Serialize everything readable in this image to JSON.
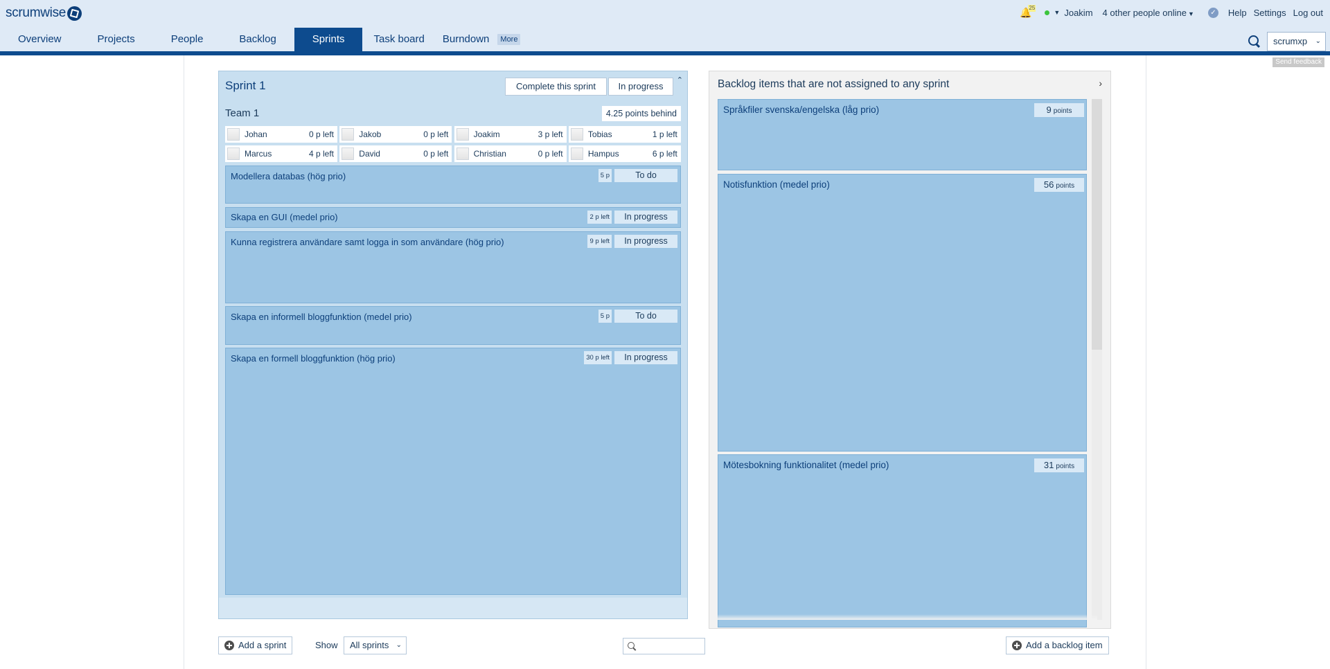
{
  "header": {
    "logo_text": "scrumwise",
    "notifications_count": "25",
    "user_name": "Joakim",
    "online_text": "4 other people online",
    "help": "Help",
    "settings": "Settings",
    "logout": "Log out"
  },
  "nav": {
    "items": [
      "Overview",
      "Projects",
      "People",
      "Backlog",
      "Sprints",
      "Task board",
      "Burndown"
    ],
    "active": "Sprints",
    "more": "More"
  },
  "project_select": {
    "value": "scrumxp"
  },
  "feedback": "Send feedback",
  "sprint": {
    "title": "Sprint 1",
    "complete_label": "Complete this sprint",
    "status": "In progress",
    "team": {
      "name": "Team 1",
      "behind": "4.25 points behind",
      "members": [
        {
          "name": "Johan",
          "left": "0 p left"
        },
        {
          "name": "Jakob",
          "left": "0 p left"
        },
        {
          "name": "Joakim",
          "left": "3 p left"
        },
        {
          "name": "Tobias",
          "left": "1 p left"
        },
        {
          "name": "Marcus",
          "left": "4 p left"
        },
        {
          "name": "David",
          "left": "0 p left"
        },
        {
          "name": "Christian",
          "left": "0 p left"
        },
        {
          "name": "Hampus",
          "left": "6 p left"
        }
      ]
    },
    "stories": [
      {
        "title": "Modellera databas (hög prio)",
        "points": "5 p",
        "status": "To do"
      },
      {
        "title": "Skapa en GUI (medel prio)",
        "points": "2 p left",
        "status": "In progress"
      },
      {
        "title": "Kunna registrera användare samt logga in som användare (hög prio)",
        "points": "9 p left",
        "status": "In progress"
      },
      {
        "title": "Skapa en informell bloggfunktion (medel prio)",
        "points": "5 p",
        "status": "To do"
      },
      {
        "title": "Skapa en formell bloggfunktion (hög prio)",
        "points": "30 p left",
        "status": "In progress"
      }
    ]
  },
  "backlog": {
    "title": "Backlog items that are not assigned to any sprint",
    "points_unit": "points",
    "items": [
      {
        "title": "Språkfiler svenska/engelska (låg prio)",
        "points": "9"
      },
      {
        "title": "Notisfunktion (medel prio)",
        "points": "56"
      },
      {
        "title": "Mötesbokning funktionalitet (medel prio)",
        "points": "31"
      }
    ]
  },
  "bottom": {
    "add_sprint": "Add a sprint",
    "show_label": "Show",
    "show_value": "All sprints",
    "add_backlog": "Add a backlog item"
  },
  "colors": {
    "brand": "#0d4b8e",
    "header_bg": "#dfeaf6",
    "story_bg": "#9cc5e4",
    "sprint_bg": "#c8dff0"
  }
}
